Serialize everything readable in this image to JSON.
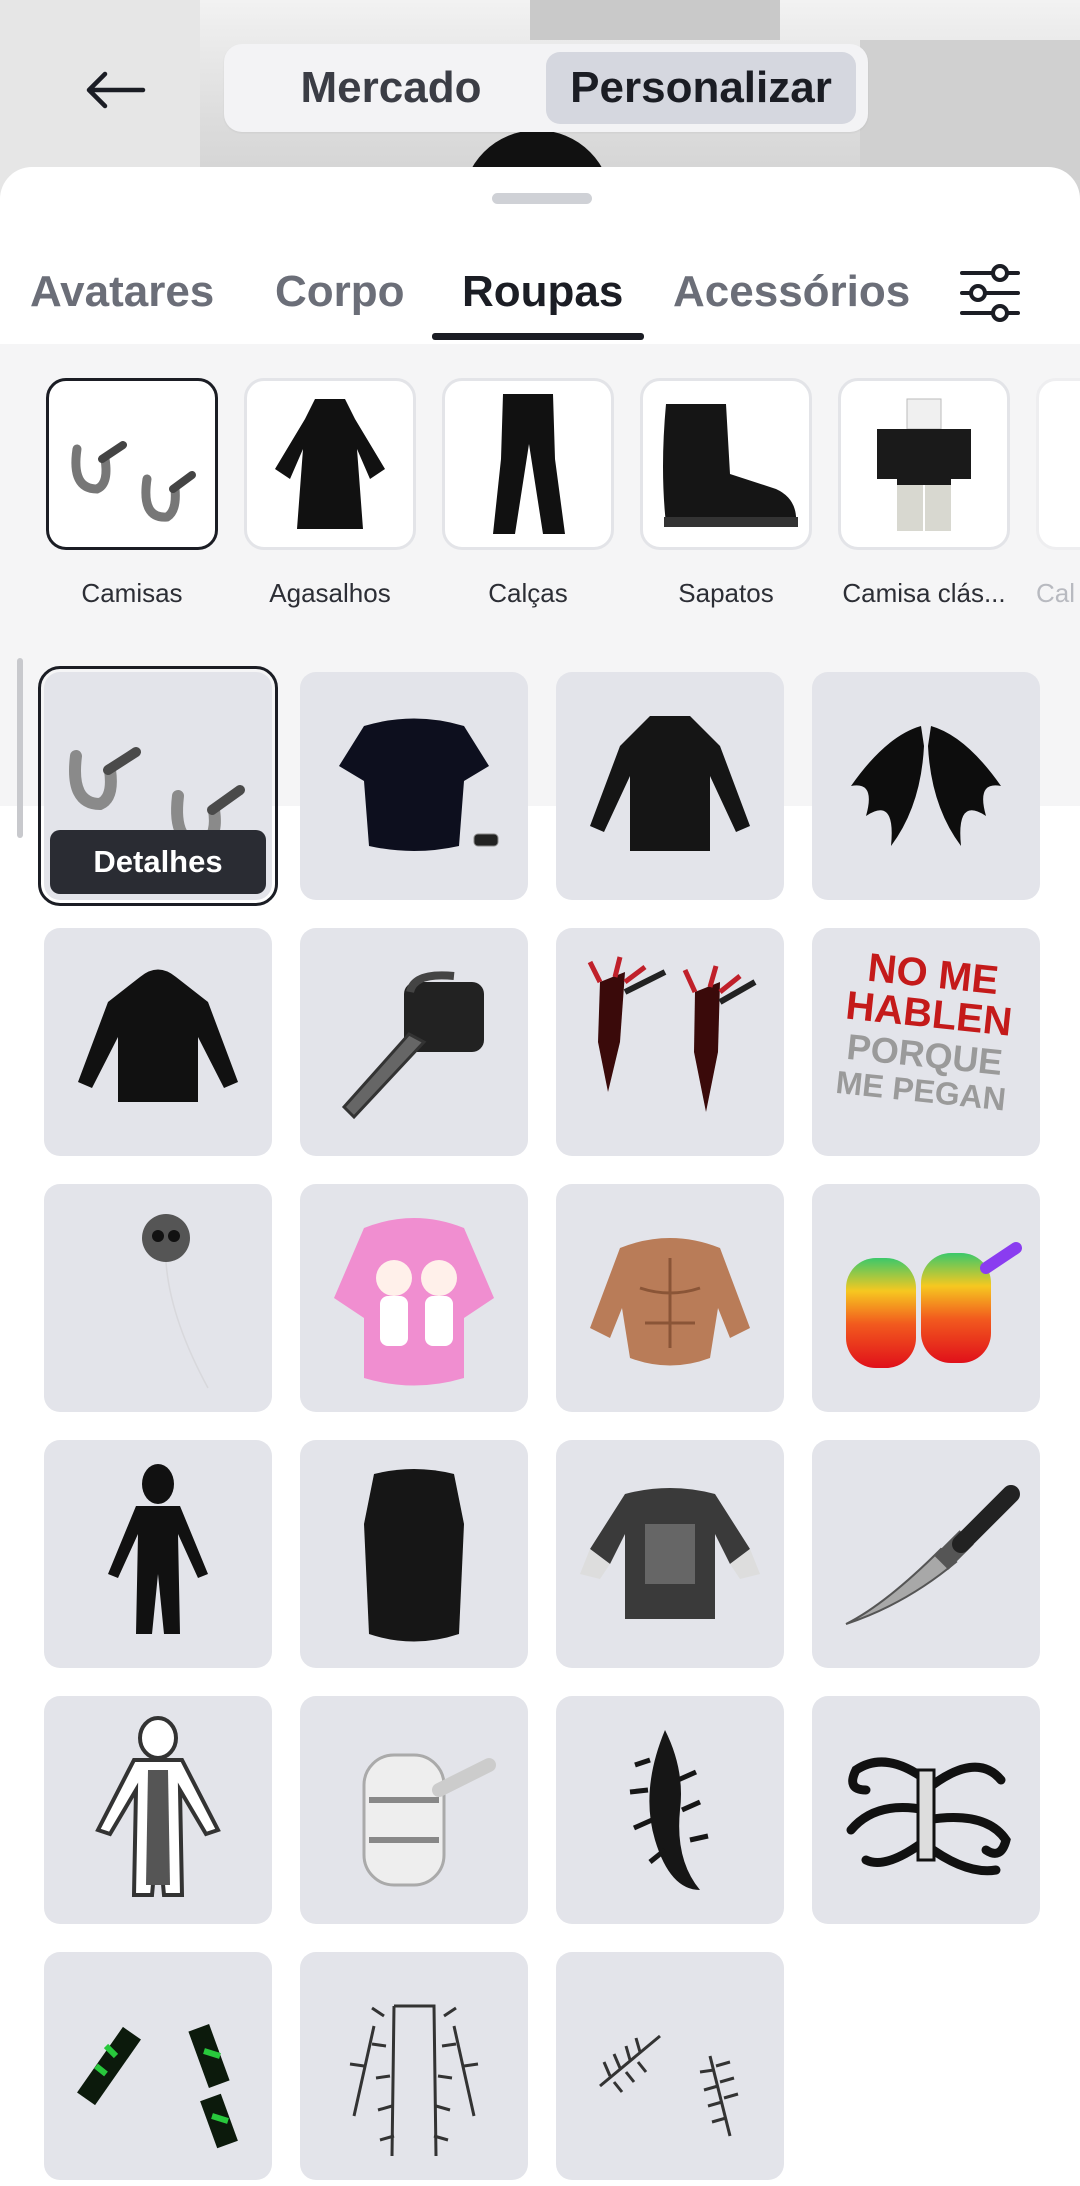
{
  "top_bar": {
    "back_icon": "arrow-left-icon",
    "segments": [
      {
        "label": "Mercado",
        "active": false
      },
      {
        "label": "Personalizar",
        "active": true
      }
    ]
  },
  "tabs": [
    {
      "label": "Avatares",
      "active": false
    },
    {
      "label": "Corpo",
      "active": false
    },
    {
      "label": "Roupas",
      "active": true
    },
    {
      "label": "Acessórios",
      "active": false
    }
  ],
  "filter_icon": "sliders-icon",
  "categories": [
    {
      "label": "Camisas",
      "icon": "shirt-hooks-icon",
      "selected": true
    },
    {
      "label": "Agasalhos",
      "icon": "black-robe-icon",
      "selected": false
    },
    {
      "label": "Calças",
      "icon": "black-pants-icon",
      "selected": false
    },
    {
      "label": "Sapatos",
      "icon": "black-boot-icon",
      "selected": false
    },
    {
      "label": "Camisa clás...",
      "icon": "classic-shirt-avatar-icon",
      "selected": false
    },
    {
      "label": "Cal",
      "icon": "classic-pants-icon",
      "selected": false
    }
  ],
  "items_grid": {
    "details_label": "Detalhes",
    "items": [
      {
        "icon": "chrome-hooks-icon",
        "selected": true
      },
      {
        "icon": "black-tshirt-icon",
        "selected": false
      },
      {
        "icon": "black-jacket-icon",
        "selected": false
      },
      {
        "icon": "black-wings-icon",
        "selected": false
      },
      {
        "icon": "black-hoodie-icon",
        "selected": false
      },
      {
        "icon": "chainsaw-icon",
        "selected": false
      },
      {
        "icon": "red-claw-arms-icon",
        "selected": false
      },
      {
        "icon": "text-shirt-icon",
        "selected": false,
        "text_lines": [
          "NO ME",
          "HABLEN",
          "PORQUE",
          "ME PEGAN"
        ]
      },
      {
        "icon": "skull-balloon-icon",
        "selected": false
      },
      {
        "icon": "pink-sweater-babies-icon",
        "selected": false
      },
      {
        "icon": "muscle-torso-icon",
        "selected": false
      },
      {
        "icon": "rainbow-barrels-icon",
        "selected": false
      },
      {
        "icon": "black-bodysuit-icon",
        "selected": false
      },
      {
        "icon": "black-vest-icon",
        "selected": false
      },
      {
        "icon": "graphic-tshirt-icon",
        "selected": false
      },
      {
        "icon": "knife-icon",
        "selected": false
      },
      {
        "icon": "white-outline-suit-icon",
        "selected": false
      },
      {
        "icon": "white-barrel-icon",
        "selected": false
      },
      {
        "icon": "spiked-tail-icon",
        "selected": false
      },
      {
        "icon": "tentacles-icon",
        "selected": false
      },
      {
        "icon": "green-gauntlets-icon",
        "selected": false
      },
      {
        "icon": "spiked-suit-icon",
        "selected": false
      },
      {
        "icon": "spiked-arms-icon",
        "selected": false
      }
    ]
  }
}
